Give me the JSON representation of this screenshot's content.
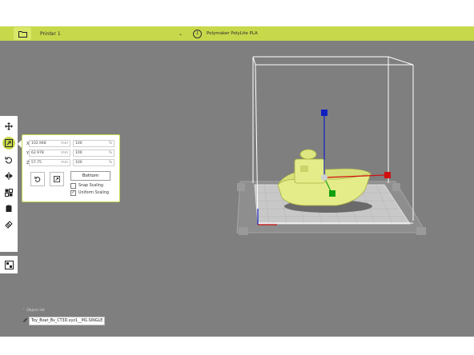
{
  "toolbar": {
    "printer": "Printer 1",
    "material_index": "1",
    "material": "Polymaker PolyLite PLA"
  },
  "sidebar": {
    "tools": [
      "move-icon",
      "scale-icon",
      "rotate-icon",
      "mirror-icon",
      "per-model-settings-icon",
      "support-blocker-icon",
      "layer-icon"
    ],
    "active_tool": "scale-icon",
    "extra": "arrange-icon"
  },
  "scale_panel": {
    "rows": [
      {
        "axis": "X",
        "size": "102.948",
        "unit": "mm",
        "percent": "100",
        "pct_unit": "%"
      },
      {
        "axis": "Y",
        "size": "62.978",
        "unit": "mm",
        "percent": "100",
        "pct_unit": "%"
      },
      {
        "axis": "Z",
        "size": "57.75",
        "unit": "mm",
        "percent": "100",
        "pct_unit": "%"
      }
    ],
    "reset_icon": "undo-icon",
    "lay_flat_icon": "lay-flat-icon",
    "bottom_label": "Bottom",
    "snap_scaling": {
      "label": "Snap Scaling",
      "checked": false
    },
    "uniform_scaling": {
      "label": "Uniform Scaling",
      "checked": true
    }
  },
  "object_list": {
    "label": "Object list",
    "file": "Toy_Boat_Bv_CT3D.xyz1__M1-SINGLE"
  },
  "colors": {
    "accent": "#c7d84b",
    "viewport": "#7f7f7f",
    "model": "#e4ec8a",
    "axis_x": "#d01010",
    "axis_y": "#10a010",
    "axis_z": "#1020c0"
  }
}
